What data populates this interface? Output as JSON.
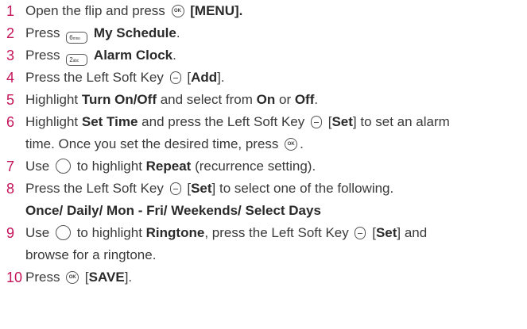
{
  "steps": [
    {
      "num": "1",
      "pre": "Open the flip and press ",
      "key": "OK key",
      "bold": "[MENU]."
    },
    {
      "num": "2",
      "pre": "Press ",
      "key": "6 key",
      "bold": "My Schedule",
      "post": "."
    },
    {
      "num": "3",
      "pre": "Press ",
      "key": "2 key",
      "bold": "Alarm Clock",
      "post": "."
    },
    {
      "num": "4",
      "pre": "Press the Left Soft Key ",
      "key": "Left Soft Key",
      "open": "[",
      "bold": "Add",
      "close": "]."
    },
    {
      "num": "5",
      "pre": "Highlight ",
      "bold1": "Turn On/Off",
      "mid": " and select from ",
      "bold2": "On",
      "or": " or ",
      "bold3": "Off",
      "post": "."
    },
    {
      "num": "6",
      "pre": "Highlight ",
      "bold1": "Set Time",
      "mid": " and press the Left Soft Key ",
      "open": "[",
      "bold2": "Set",
      "close": "] to set an alarm",
      "line2": "time. Once you set the desired time, press ",
      "line2end": "."
    },
    {
      "num": "7",
      "pre": "Use ",
      "mid": " to highlight ",
      "bold": "Repeat",
      "post": " (recurrence setting)."
    },
    {
      "num": "8",
      "pre": "Press the Left Soft Key ",
      "open": "[",
      "bold": "Set",
      "close": "] to select one of the following.",
      "line2": "Once/ Daily/ Mon - Fri/ Weekends/ Select Days"
    },
    {
      "num": "9",
      "pre": "Use ",
      "mid": " to highlight ",
      "bold": "Ringtone",
      "mid2": ", press the Left Soft Key ",
      "open": "[",
      "bold2": "Set",
      "close": "] and",
      "line2": "browse for a ringtone."
    },
    {
      "num": "10",
      "pre": "Press ",
      "open": "[",
      "bold": "SAVE",
      "close": "]."
    }
  ],
  "keys": {
    "ok": "OK",
    "six": "6",
    "six_sub": "mno",
    "two": "2",
    "two_sub": "abc"
  }
}
